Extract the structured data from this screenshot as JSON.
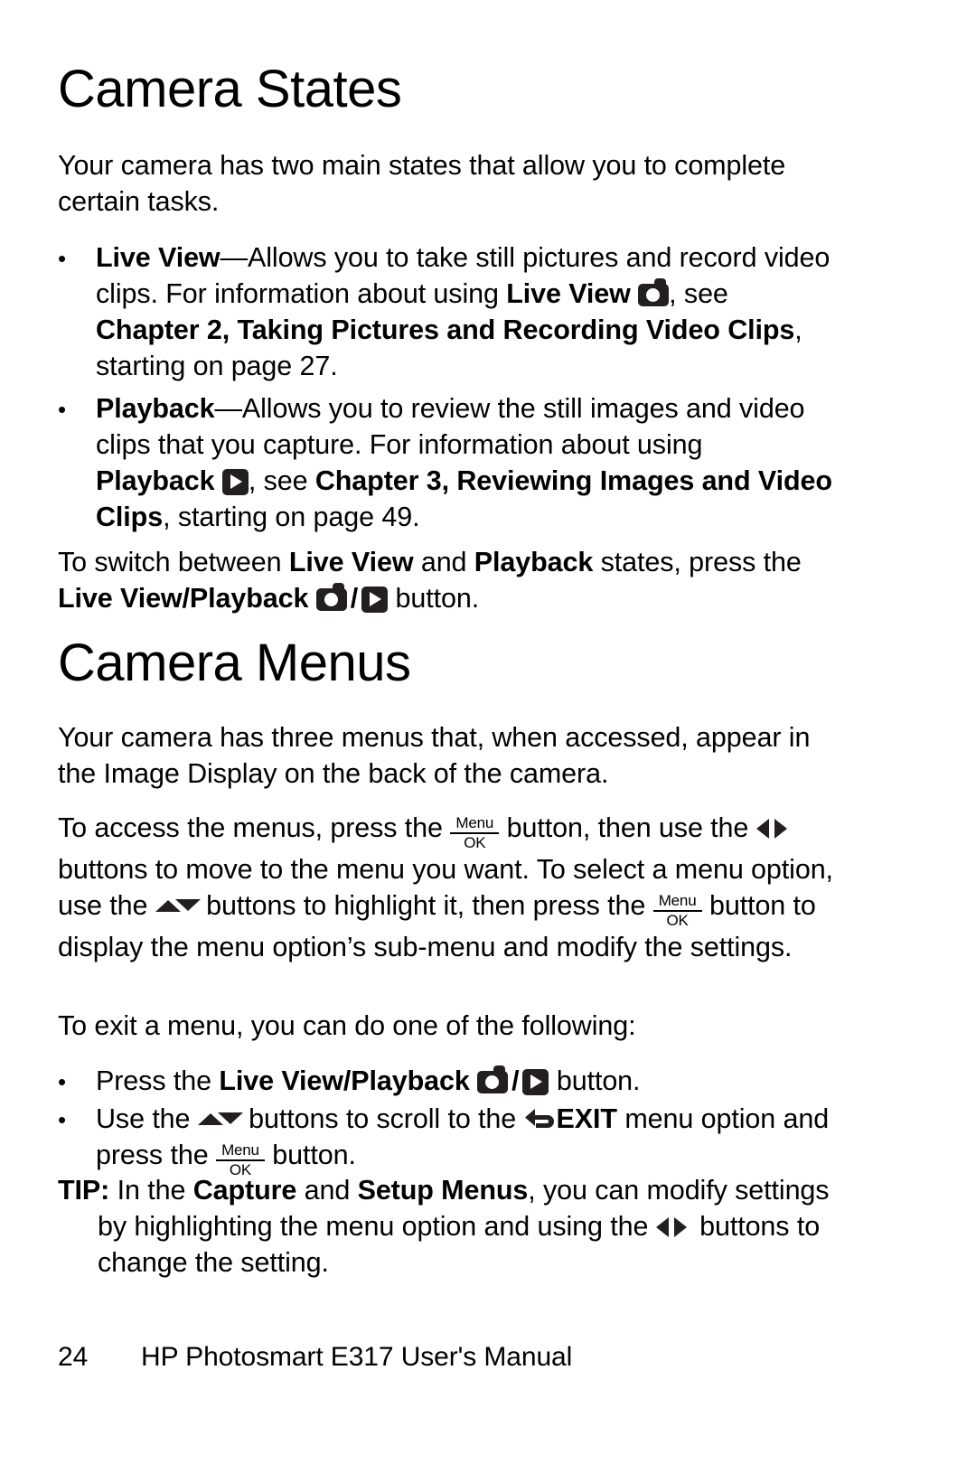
{
  "page": {
    "number": "24",
    "footer_title": "HP Photosmart E317 User's Manual"
  },
  "sections": [
    {
      "heading": "Camera States",
      "intro": "Your camera has two main states that allow you to complete certain tasks."
    },
    {
      "heading": "Camera Menus",
      "intro": "Your camera has three menus that, when accessed, appear in the Image Display on the back of the camera."
    }
  ],
  "states_bullets": [
    {
      "term": "Live View",
      "dash": "—",
      "text_1": "Allows you to take still pictures and record video clips. For information about using ",
      "term_2": "Live View",
      "icon": "camera-icon",
      "text_2": ", see ",
      "ref": "Chapter 2, Taking Pictures and Recording Video Clips",
      "text_3": ", starting on page 27."
    },
    {
      "term": "Playback",
      "dash": "—",
      "text_1": "Allows you to review the still images and video clips that you capture. For information about using ",
      "term_2": "Playback",
      "icon": "playback-icon",
      "text_2": ", see ",
      "ref": "Chapter 3, Reviewing Images and Video Clips",
      "text_3": ", starting on page 49."
    }
  ],
  "switch_paragraph": {
    "t1": "To switch between ",
    "b1": "Live View",
    "t2": " and ",
    "b2": "Playback",
    "t3": " states, press the ",
    "b3": "Live View/Playback",
    "icon_camera": "camera-icon",
    "slash": "/",
    "icon_playback": "playback-icon",
    "t4": " button."
  },
  "access_paragraph": {
    "t1": "To access the menus, press the ",
    "icon_menuok": "menu-ok-icon",
    "t2": " button, then use the ",
    "icon_leftright": "left-right-arrows-icon",
    "t3": " buttons to move to the menu you want. To select a menu option, use the ",
    "icon_updown": "up-down-arrows-icon",
    "t4": " buttons to highlight it, then press the ",
    "icon_menuok_2": "menu-ok-icon",
    "t5": " button to display the menu option’s sub-menu and modify the settings."
  },
  "exit_intro": "To exit a menu, you can do one of the following:",
  "exit_bullets": [
    {
      "t1": "Press the ",
      "b1": "Live View/Playback",
      "icon_camera": "camera-icon",
      "slash": "/",
      "icon_playback": "playback-icon",
      "t2": " button."
    },
    {
      "t1": "Use the ",
      "icon_updown": "up-down-arrows-icon",
      "t2": " buttons to scroll to the ",
      "icon_exit": "exit-back-arrow-icon",
      "b1": "EXIT",
      "t3": " menu option and press the ",
      "icon_menuok": "menu-ok-icon",
      "t4": " button."
    }
  ],
  "tip": {
    "label": "TIP:",
    "t1": " In the ",
    "b1": "Capture",
    "t2": " and ",
    "b2": "Setup Menus",
    "t3": ", you can modify settings by highlighting the menu option and using the ",
    "icon_leftright": "left-right-arrows-icon",
    "t4": " buttons to change the setting."
  },
  "icon_labels": {
    "menu": "Menu",
    "ok": "OK"
  },
  "colors": {
    "text": "#000000",
    "icon_fill": "#231f20",
    "background": "#ffffff"
  }
}
